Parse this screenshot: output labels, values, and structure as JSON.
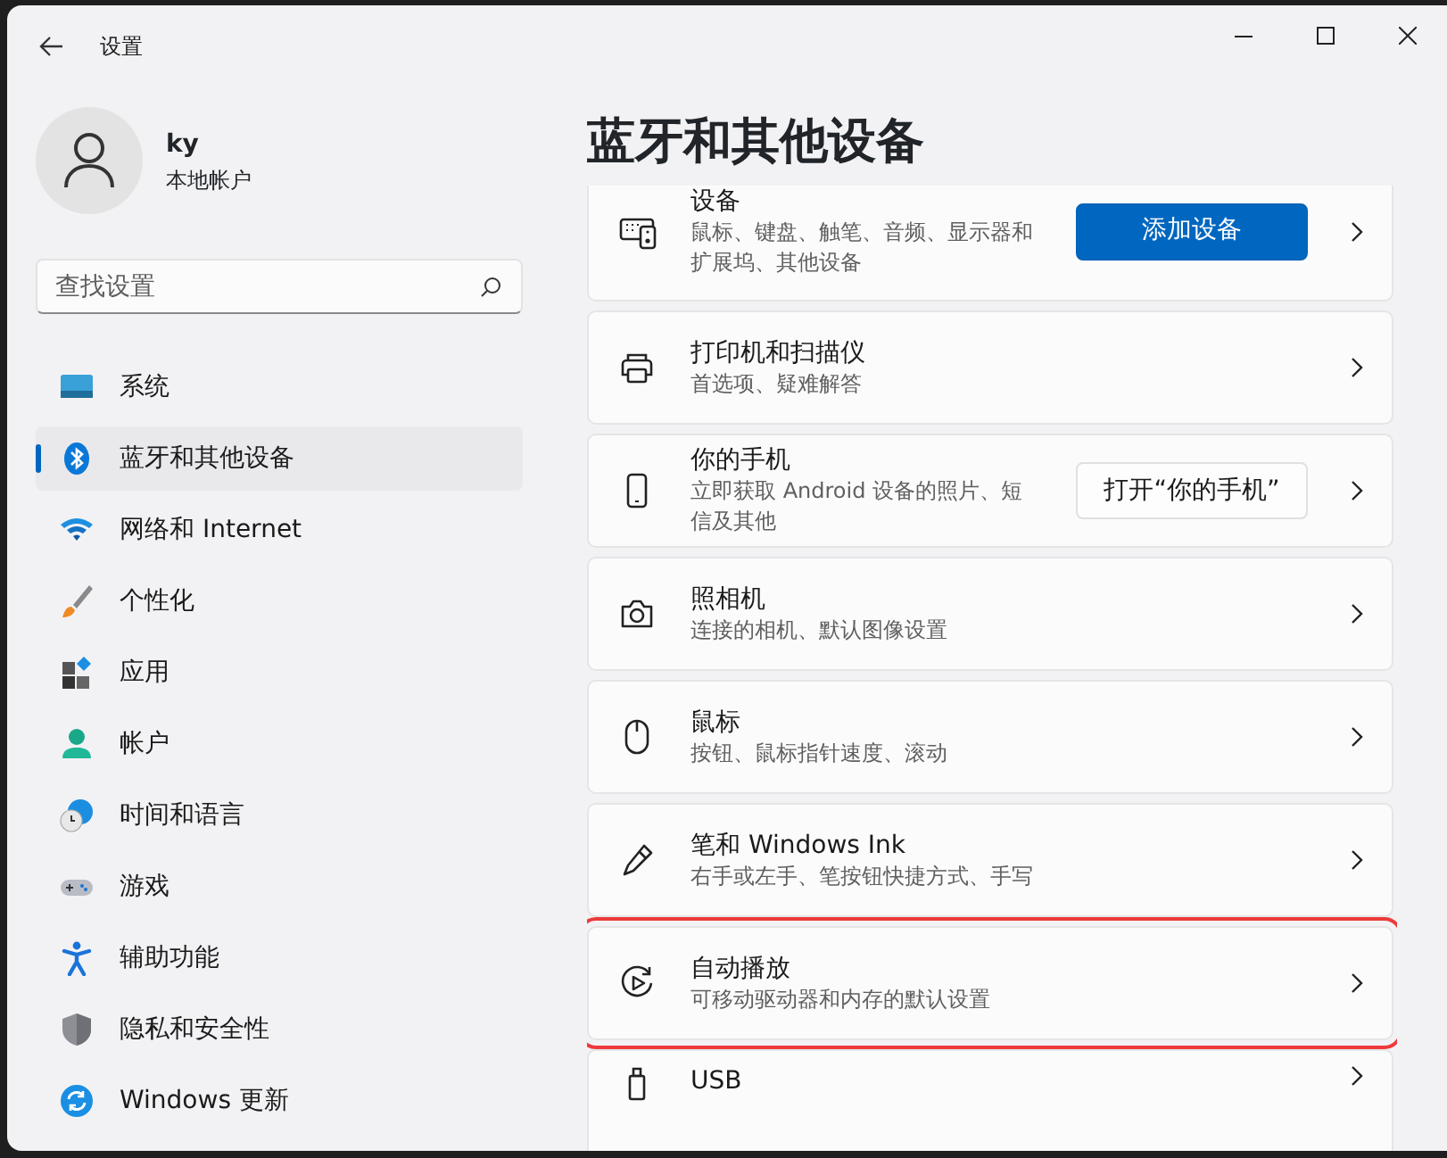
{
  "window": {
    "title": "设置"
  },
  "user": {
    "name": "ky",
    "account_type": "本地帐户"
  },
  "search": {
    "placeholder": "查找设置"
  },
  "sidebar": {
    "items": [
      {
        "kind": "system",
        "label": "系统",
        "selected": false
      },
      {
        "kind": "bluetooth",
        "label": "蓝牙和其他设备",
        "selected": true
      },
      {
        "kind": "network",
        "label": "网络和 Internet",
        "selected": false
      },
      {
        "kind": "personalize",
        "label": "个性化",
        "selected": false
      },
      {
        "kind": "apps",
        "label": "应用",
        "selected": false
      },
      {
        "kind": "accounts",
        "label": "帐户",
        "selected": false
      },
      {
        "kind": "time",
        "label": "时间和语言",
        "selected": false
      },
      {
        "kind": "gaming",
        "label": "游戏",
        "selected": false
      },
      {
        "kind": "accessibility",
        "label": "辅助功能",
        "selected": false
      },
      {
        "kind": "privacy",
        "label": "隐私和安全性",
        "selected": false
      },
      {
        "kind": "update",
        "label": "Windows 更新",
        "selected": false
      }
    ]
  },
  "page": {
    "title": "蓝牙和其他设备"
  },
  "cards": [
    {
      "kind": "devices",
      "title": "设备",
      "description": "鼠标、键盘、触笔、音频、显示器和扩展坞、其他设备",
      "button": {
        "label": "添加设备",
        "primary": true
      },
      "highlighted": false
    },
    {
      "kind": "printer",
      "title": "打印机和扫描仪",
      "description": "首选项、疑难解答",
      "highlighted": false
    },
    {
      "kind": "phone",
      "title": "你的手机",
      "description": "立即获取 Android 设备的照片、短信及其他",
      "button": {
        "label": "打开“你的手机”",
        "primary": false
      },
      "highlighted": false
    },
    {
      "kind": "camera",
      "title": "照相机",
      "description": "连接的相机、默认图像设置",
      "highlighted": false
    },
    {
      "kind": "mouse",
      "title": "鼠标",
      "description": "按钮、鼠标指针速度、滚动",
      "highlighted": false
    },
    {
      "kind": "pen",
      "title": "笔和 Windows Ink",
      "description": "右手或左手、笔按钮快捷方式、手写",
      "highlighted": false
    },
    {
      "kind": "autoplay",
      "title": "自动播放",
      "description": "可移动驱动器和内存的默认设置",
      "highlighted": true
    },
    {
      "kind": "usb",
      "title": "USB",
      "highlighted": false
    }
  ]
}
